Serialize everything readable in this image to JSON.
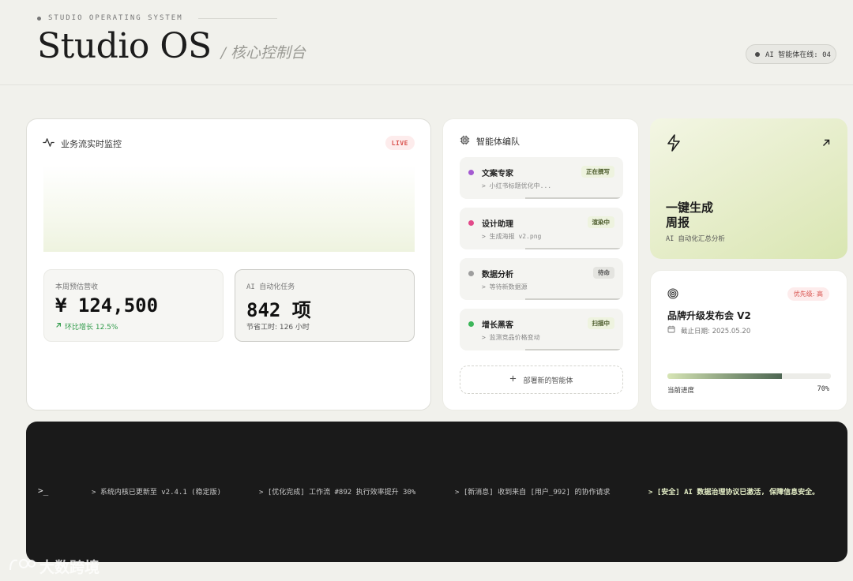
{
  "header": {
    "kicker": "STUDIO OPERATING SYSTEM",
    "title": "Studio OS",
    "subtitle": "/ 核心控制台",
    "online_status": "AI 智能体在线: 04"
  },
  "monitor": {
    "title": "业务流实时监控",
    "live_badge": "LIVE",
    "revenue": {
      "label": "本周预估营收",
      "value": "¥ 124,500",
      "growth": "环比增长 12.5%"
    },
    "tasks": {
      "label": "AI 自动化任务",
      "value": "842 项",
      "note": "节省工时: 126 小时"
    }
  },
  "squad": {
    "title": "智能体编队",
    "agents": [
      {
        "name": "文案专家",
        "task": "> 小红书标题优化中...",
        "status": "正在撰写",
        "dot_color": "#a45ad1",
        "badge_bg": "#eef3df",
        "badge_color": "#4a5a2a"
      },
      {
        "name": "设计助理",
        "task": "> 生成海报 v2.png",
        "status": "渲染中",
        "dot_color": "#e24a8a",
        "badge_bg": "#eef3df",
        "badge_color": "#4a5a2a"
      },
      {
        "name": "数据分析",
        "task": "> 等待新数据源",
        "status": "待命",
        "dot_color": "#9e9e9e",
        "badge_bg": "#e4e4e0",
        "badge_color": "#555555"
      },
      {
        "name": "增长黑客",
        "task": "> 监测竞品价格变动",
        "status": "扫描中",
        "dot_color": "#3cb65a",
        "badge_bg": "#eef3df",
        "badge_color": "#4a5a2a"
      }
    ],
    "deploy_button": "部署新的智能体"
  },
  "generate": {
    "title_line1": "一键生成",
    "title_line2": "周报",
    "subtitle": "AI 自动化汇总分析"
  },
  "project": {
    "priority": "优先级: 高",
    "name": "品牌升级发布会 V2",
    "deadline": "截止日期: 2025.05.20",
    "progress_label": "当前进度",
    "progress_value": "70%",
    "progress_fraction": 0.7
  },
  "terminal": {
    "prompt": ">_",
    "logs": [
      "> 系统内核已更新至 v2.4.1 (稳定版)",
      "> [优化完成] 工作流 #892 执行效率提升 30%",
      "> [新消息] 收到来自 [用户_992] 的协作请求",
      "> [安全] AI 数据治理协议已激活, 保障信息安全。"
    ]
  },
  "watermark": "大数跨境"
}
